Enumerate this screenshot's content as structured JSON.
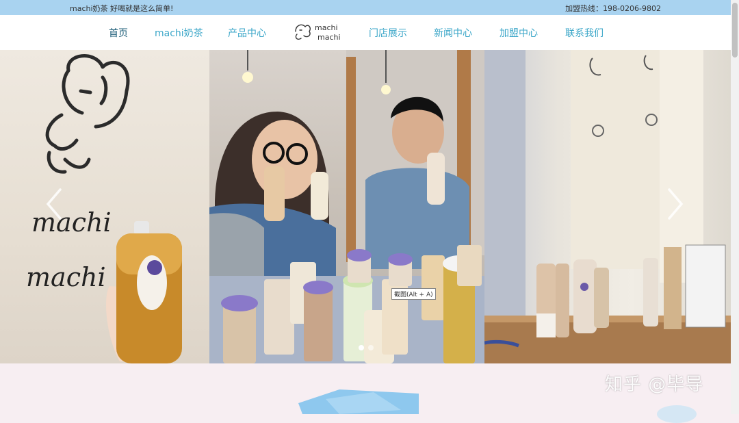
{
  "topbar": {
    "slogan": "machi奶茶 好喝就是这么简单!",
    "hotline": "加盟热线：198-0206-9802"
  },
  "nav": {
    "items": [
      {
        "label": "首页"
      },
      {
        "label": "machi奶茶"
      },
      {
        "label": "产品中心"
      },
      {
        "label": "门店展示"
      },
      {
        "label": "新闻中心"
      },
      {
        "label": "加盟中心"
      },
      {
        "label": "联系我们"
      }
    ],
    "logo_text": [
      "machi",
      "machi"
    ],
    "active_color": "#1f5f7a",
    "link_color": "#3aa6c8"
  },
  "banner": {
    "wall_text": [
      "machi",
      "machi"
    ],
    "slides": 2,
    "current_slide": 1
  },
  "tooltip": {
    "text": "截图(Alt + A)"
  },
  "watermark": {
    "text": "知乎 @毕导"
  },
  "colors": {
    "topbar": "#a9d3f0",
    "page_bg": "#f7eef2",
    "accent": "#3aa6c8"
  }
}
